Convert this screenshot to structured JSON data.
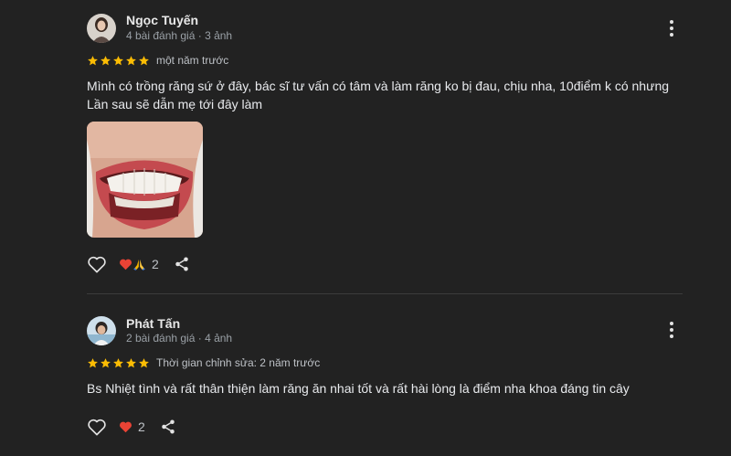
{
  "colors": {
    "background": "#222222",
    "star": "#fbbc04",
    "heart": "#ea4335"
  },
  "reviews": [
    {
      "author": "Ngọc Tuyến",
      "stats": "4 bài đánh giá · 3 ảnh",
      "rating": 5,
      "time": "một năm trước",
      "text_line1": "Mình có trồng răng sứ ở đây, bác sĩ tư vấn có tâm và làm răng ko bị đau, chịu nha, 10điểm k có nhưng",
      "text_line2": "Lần sau sẽ dẫn mẹ tới đây làm",
      "reaction_icons": [
        "red-heart-icon",
        "folded-hands-icon"
      ],
      "reaction_count": "2"
    },
    {
      "author": "Phát Tấn",
      "stats": "2 bài đánh giá · 4 ảnh",
      "rating": 5,
      "time": "Thời gian chỉnh sửa: 2 năm trước",
      "text_line1": "Bs Nhiệt tình và rất thân thiện làm răng ăn nhai tốt và rất hài lòng là điểm nha khoa đáng tin cây",
      "reaction_icons": [
        "red-heart-icon"
      ],
      "reaction_count": "2"
    }
  ]
}
